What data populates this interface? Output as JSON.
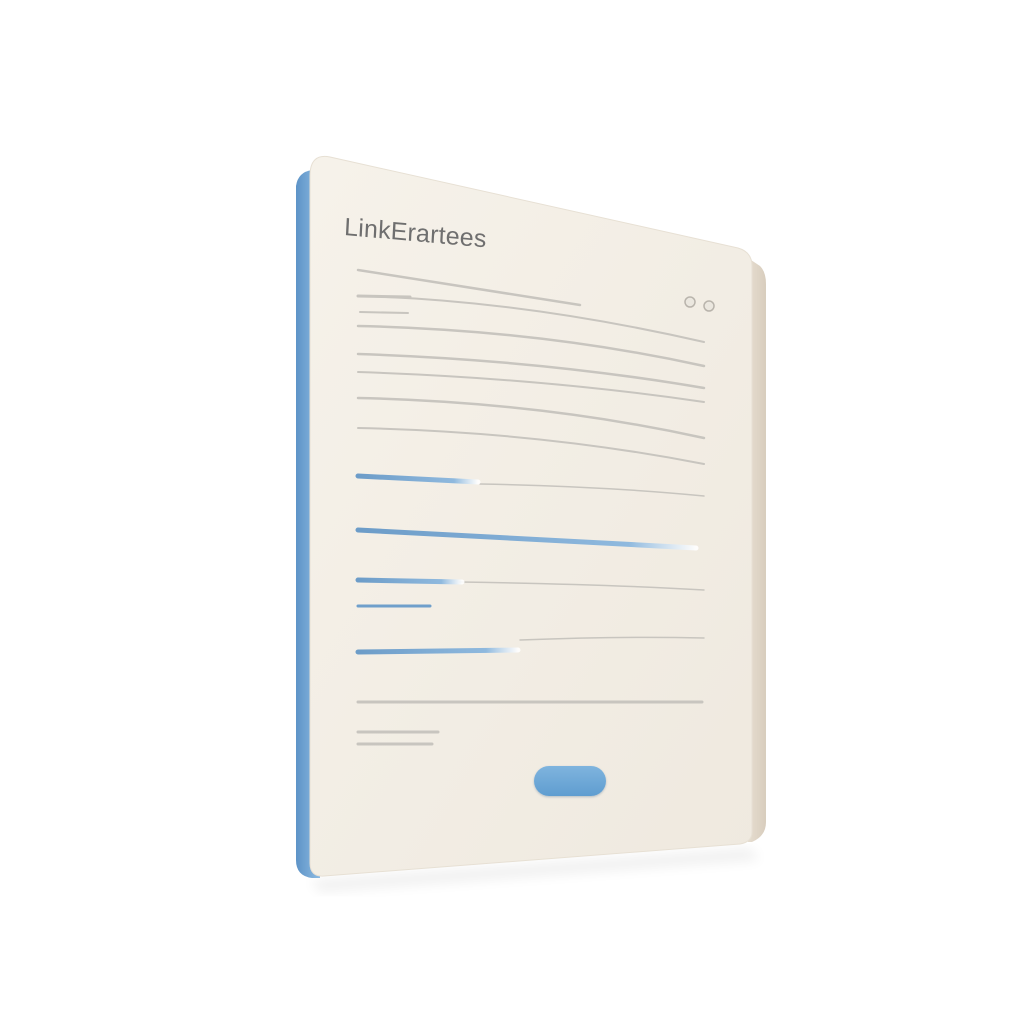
{
  "document": {
    "title": "LinkErartees"
  },
  "colors": {
    "page": "#f4efe6",
    "spine": "#6fa3d2",
    "line": "#c9c6c0",
    "accent": "#5f9dd0",
    "title": "#6f6f6f"
  },
  "window_controls": [
    "dot-icon",
    "dot-icon"
  ]
}
